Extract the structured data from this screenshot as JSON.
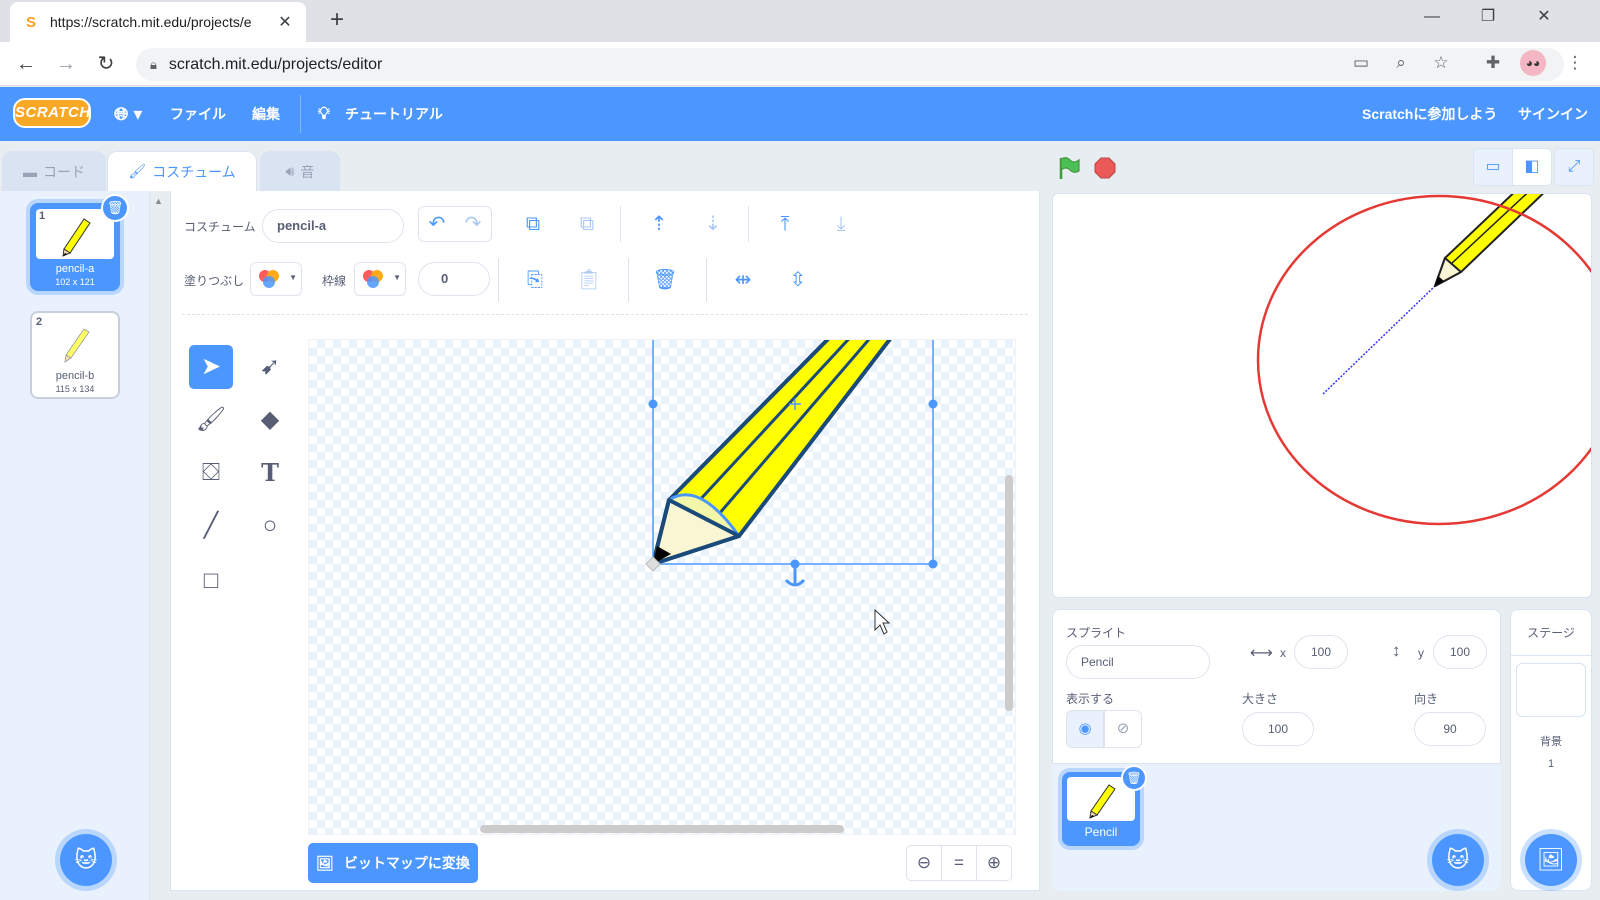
{
  "browser": {
    "tab_title": "https://scratch.mit.edu/projects/e",
    "tab_favicon": "scratch-favicon",
    "url": "scratch.mit.edu/projects/editor"
  },
  "menu": {
    "logo": "SCRATCH",
    "file": "ファイル",
    "edit": "編集",
    "tutorials": "チュートリアル",
    "join": "Scratchに参加しよう",
    "signin": "サインイン"
  },
  "editor_tabs": {
    "code": "コード",
    "costumes": "コスチューム",
    "sounds": "音"
  },
  "costumes": [
    {
      "num": "1",
      "name": "pencil-a",
      "size": "102 x 121",
      "selected": true
    },
    {
      "num": "2",
      "name": "pencil-b",
      "size": "115 x 134",
      "selected": false
    }
  ],
  "paint": {
    "costume_label": "コスチューム",
    "costume_name": "pencil-a",
    "fill_label": "塗りつぶし",
    "outline_label": "枠線",
    "outline_width": "0",
    "bitmap_button": "ビットマップに変換",
    "zoom_reset": "="
  },
  "sprite_info": {
    "sprite_label": "スプライト",
    "sprite_name": "Pencil",
    "x_label": "x",
    "x": "100",
    "y_label": "y",
    "y": "100",
    "show_label": "表示する",
    "size_label": "大きさ",
    "size": "100",
    "direction_label": "向き",
    "direction": "90"
  },
  "sprites": [
    {
      "name": "Pencil"
    }
  ],
  "stage_pane": {
    "title": "ステージ",
    "backdrops_label": "背景",
    "backdrops_count": "1"
  },
  "colors": {
    "scratch_blue": "#4c97ff",
    "green_flag": "#4cbf56",
    "stop": "#ec5959",
    "pencil_yellow": "#ffff00",
    "annotation_circle": "#e53935"
  }
}
